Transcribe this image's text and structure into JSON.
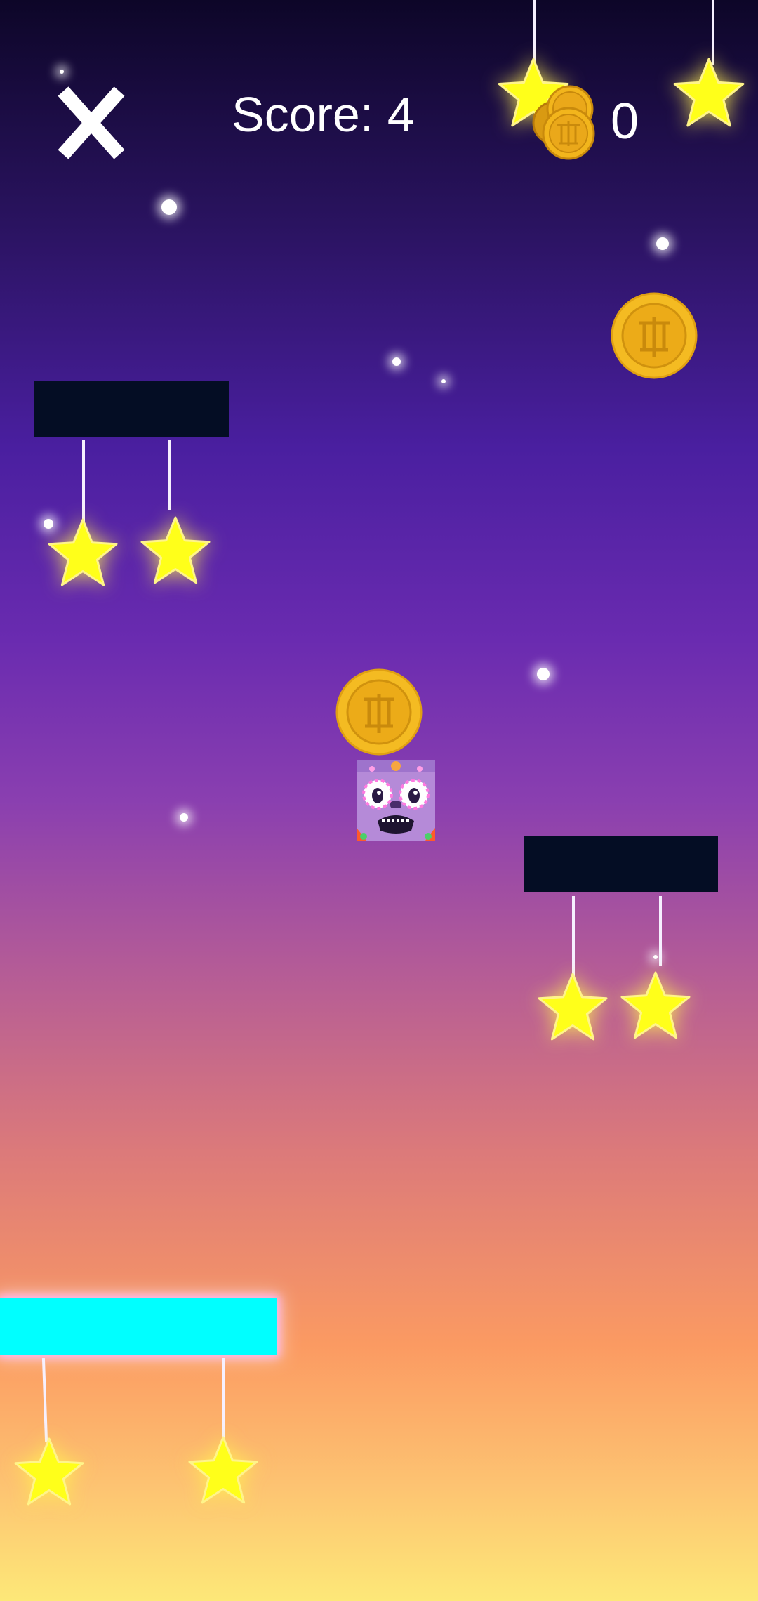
{
  "hud": {
    "close_label": "X",
    "score_text": "Score: 4",
    "coin_count": "0",
    "close_icon": "close-icon",
    "coin_icon": "coin-stack-icon"
  },
  "game": {
    "player_icon": "tiki-mask-block",
    "item_icons": [
      "coin-icon",
      "star-icon"
    ],
    "colors": {
      "star": "#ffff1a",
      "coin": "#f2b51c",
      "dark_platform": "#040d24",
      "cyan_platform": "#00ffff"
    }
  }
}
